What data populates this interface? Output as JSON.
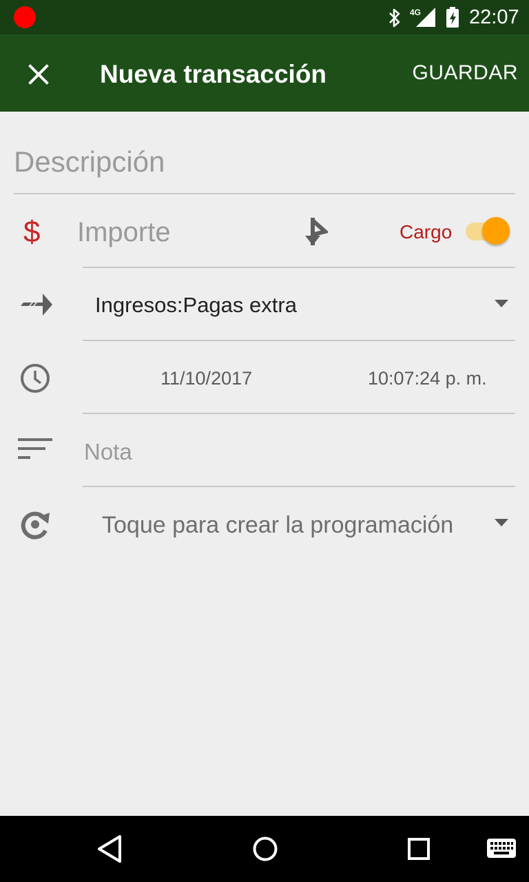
{
  "status_bar": {
    "network": "4G",
    "time": "22:07",
    "icons": [
      "recording-dot-icon",
      "bluetooth-icon",
      "signal-icon",
      "battery-charging-icon"
    ]
  },
  "app_bar": {
    "close_icon": "close-icon",
    "title": "Nueva transacción",
    "save_label": "GUARDAR"
  },
  "form": {
    "description": {
      "placeholder": "Descripción"
    },
    "amount": {
      "currency_symbol": "$",
      "placeholder": "Importe",
      "split_icon": "split-icon",
      "type_label": "Cargo",
      "type_toggle_on": true
    },
    "account": {
      "icon": "transfer-arrow-icon",
      "value": "Ingresos:Pagas extra"
    },
    "datetime": {
      "icon": "clock-icon",
      "date": "11/10/2017",
      "time": "10:07:24 p. m."
    },
    "note": {
      "icon": "notes-icon",
      "placeholder": "Nota"
    },
    "schedule": {
      "icon": "recurrence-icon",
      "value": "Toque para crear la programación"
    }
  },
  "nav_bar": {
    "buttons": [
      "back-icon",
      "home-icon",
      "recents-icon",
      "keyboard-icon"
    ]
  },
  "colors": {
    "status_bar": "#173f13",
    "app_bar": "#1e4f19",
    "background": "#eeeeee",
    "debit_red": "#c62828",
    "toggle_accent": "#ffa000"
  }
}
